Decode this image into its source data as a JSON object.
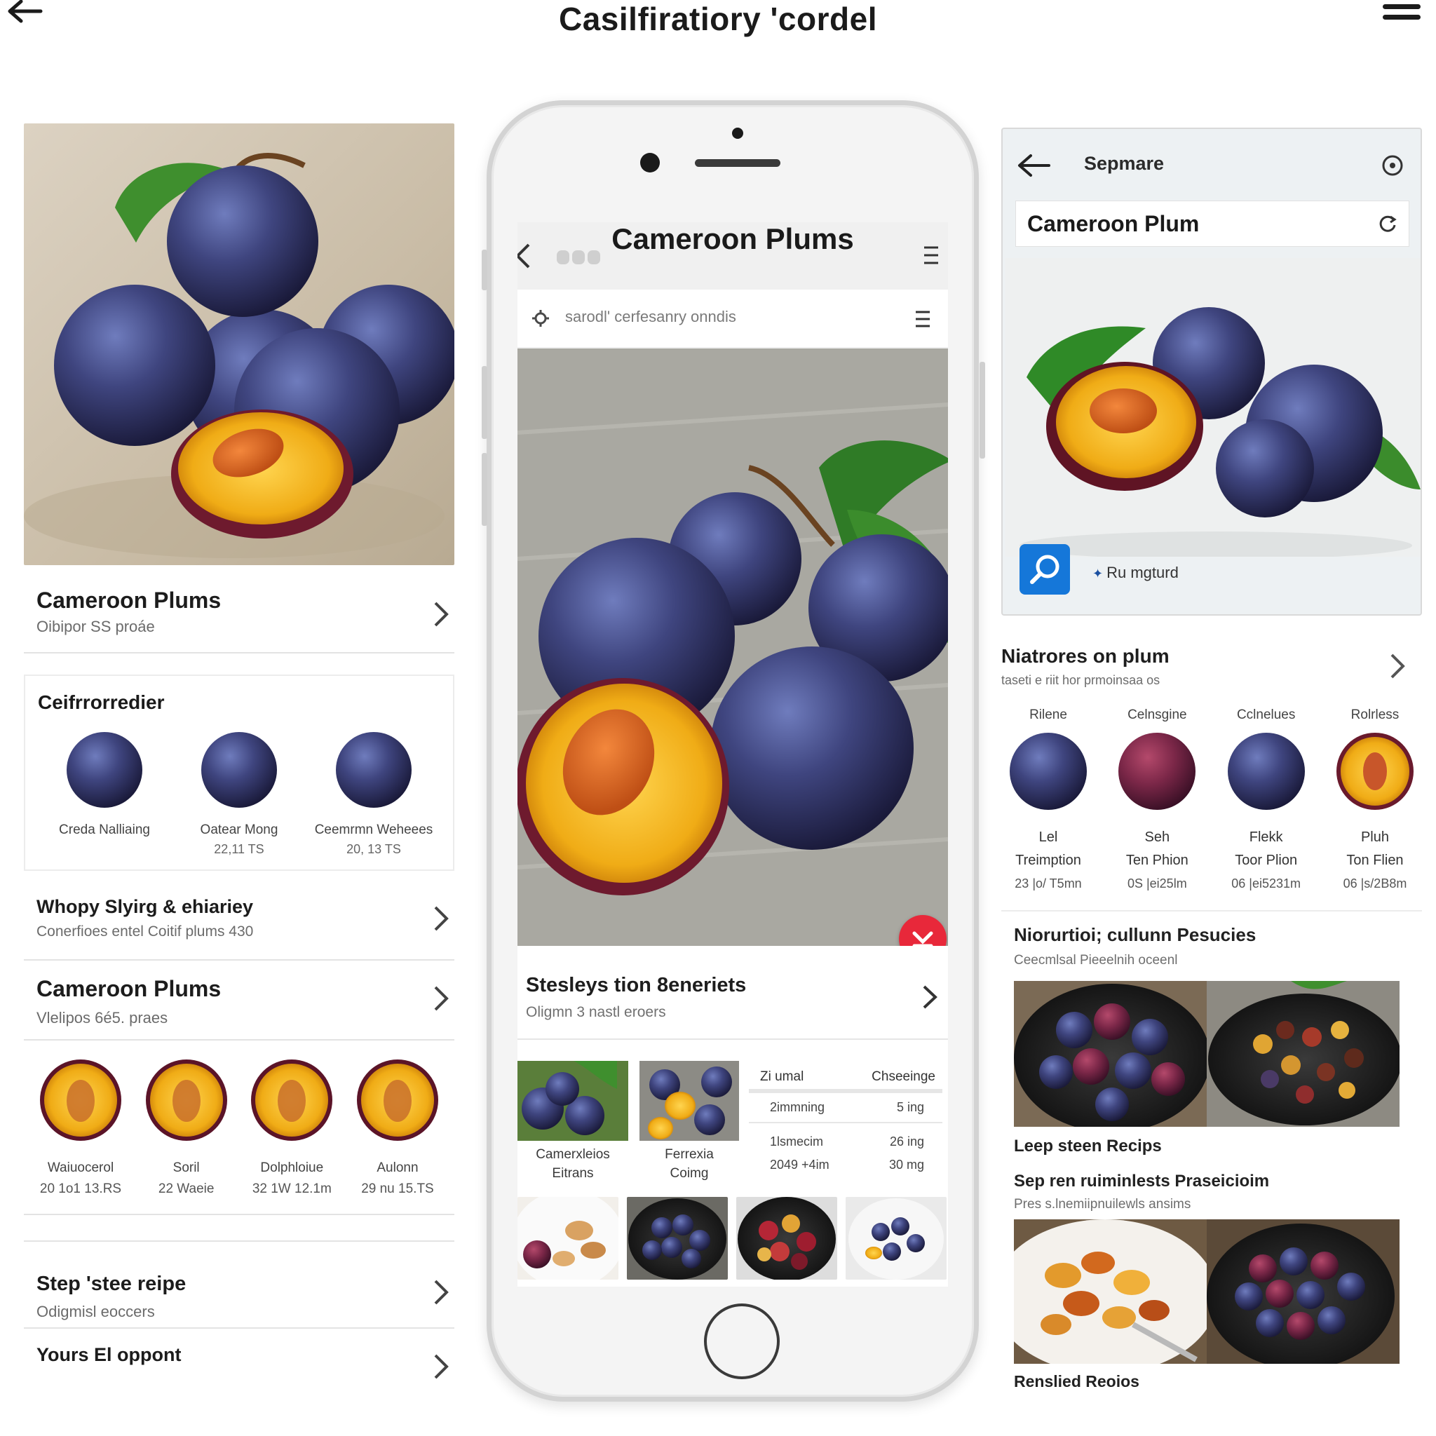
{
  "header": {
    "title": "Casilfiratiory 'cordel"
  },
  "left": {
    "row1": {
      "title": "Cameroon Plums",
      "sub": "Oibipor SS proáe"
    },
    "card": {
      "title": "Ceifrrorredier",
      "items": [
        {
          "l1": "Creda Nalliaing",
          "l2": ""
        },
        {
          "l1": "Oatear Mong",
          "l2": "22,11 TS"
        },
        {
          "l1": "Ceemrmn Weheees",
          "l2": "20, 13 TS"
        }
      ]
    },
    "row2": {
      "title": "Whopy Slyirg & ehiariey",
      "sub": "Conerfioes entel Coitif plums 430"
    },
    "row3": {
      "title": "Cameroon Plums",
      "sub": "Vlelipos 6é5. praes"
    },
    "halves": [
      {
        "l1": "Waiuocerol",
        "l2": "20 1o1 13.RS"
      },
      {
        "l1": "Soril",
        "l2": "22 Waeie"
      },
      {
        "l1": "Dolphloiue",
        "l2": "32 1W 12.1m"
      },
      {
        "l1": "Aulonn",
        "l2": "29 nu 15.TS"
      }
    ],
    "row4": {
      "title": "Step 'stee reipe",
      "sub": "Odigmisl eoccers"
    },
    "row5": {
      "title": "Yours El oppont",
      "sub": ""
    }
  },
  "phone": {
    "title": "Cameroon Plums",
    "search_placeholder": "sarodl' cerfesanry onndis",
    "row": {
      "title": "Stesleys tion 8eneriets",
      "sub": "Oligmn 3 nastl eroers"
    },
    "captions": [
      {
        "a": "Camerxleios",
        "b": "Eitrans"
      },
      {
        "a": "Ferrexia",
        "b": "Coimg"
      }
    ],
    "nutrition": {
      "head_left": "Zi umal",
      "head_right": "Chseeinge",
      "rows": [
        {
          "k": "2immning",
          "v": "5 ing"
        },
        {
          "k": "1lsmecim",
          "v": "26 ing"
        },
        {
          "k": "2049 +4im",
          "v": "30 mg"
        }
      ]
    }
  },
  "right": {
    "top_label": "Sepmare",
    "search_text": "Cameroon Plum",
    "action_label": "Ru mgturd",
    "section": {
      "title": "Niatrores on plum",
      "sub": "taseti e riit hor prmoinsaa os"
    },
    "varieties": [
      {
        "top": "Rilene",
        "v1": "Lel",
        "v2": "Treimption",
        "v3": "23 |o/ T5mn"
      },
      {
        "top": "Celnsgine",
        "v1": "Seh",
        "v2": "Ten Phion",
        "v3": "0S |ei25lm"
      },
      {
        "top": "Cclnelues",
        "v1": "Flekk",
        "v2": "Toor Plion",
        "v3": "06 |ei5231m"
      },
      {
        "top": "Rolrless",
        "v1": "Pluh",
        "v2": "Ton Flien",
        "v3": "06 |s/2B8m"
      }
    ],
    "news": {
      "title": "Niorurtioi; cullunn Pesucies",
      "sub": "Ceecmlsal Pieeelnih oceenl"
    },
    "cap1": "Leep steen Recips",
    "cap2": "Sep ren ruiminlests Praseicioim",
    "cap2_sub": "Pres s.lnemiipnuilewls ansims",
    "cap3": "Renslied Reoios"
  },
  "colors": {
    "accent_blue": "#1577d9",
    "badge_red": "#e8283a",
    "plum": "#3b3f78",
    "flesh": "#f0b21f"
  },
  "icons": [
    "back-arrow-icon",
    "menu-icon",
    "chevron-right-icon",
    "search-icon",
    "settings-icon",
    "refresh-icon",
    "download-icon"
  ]
}
